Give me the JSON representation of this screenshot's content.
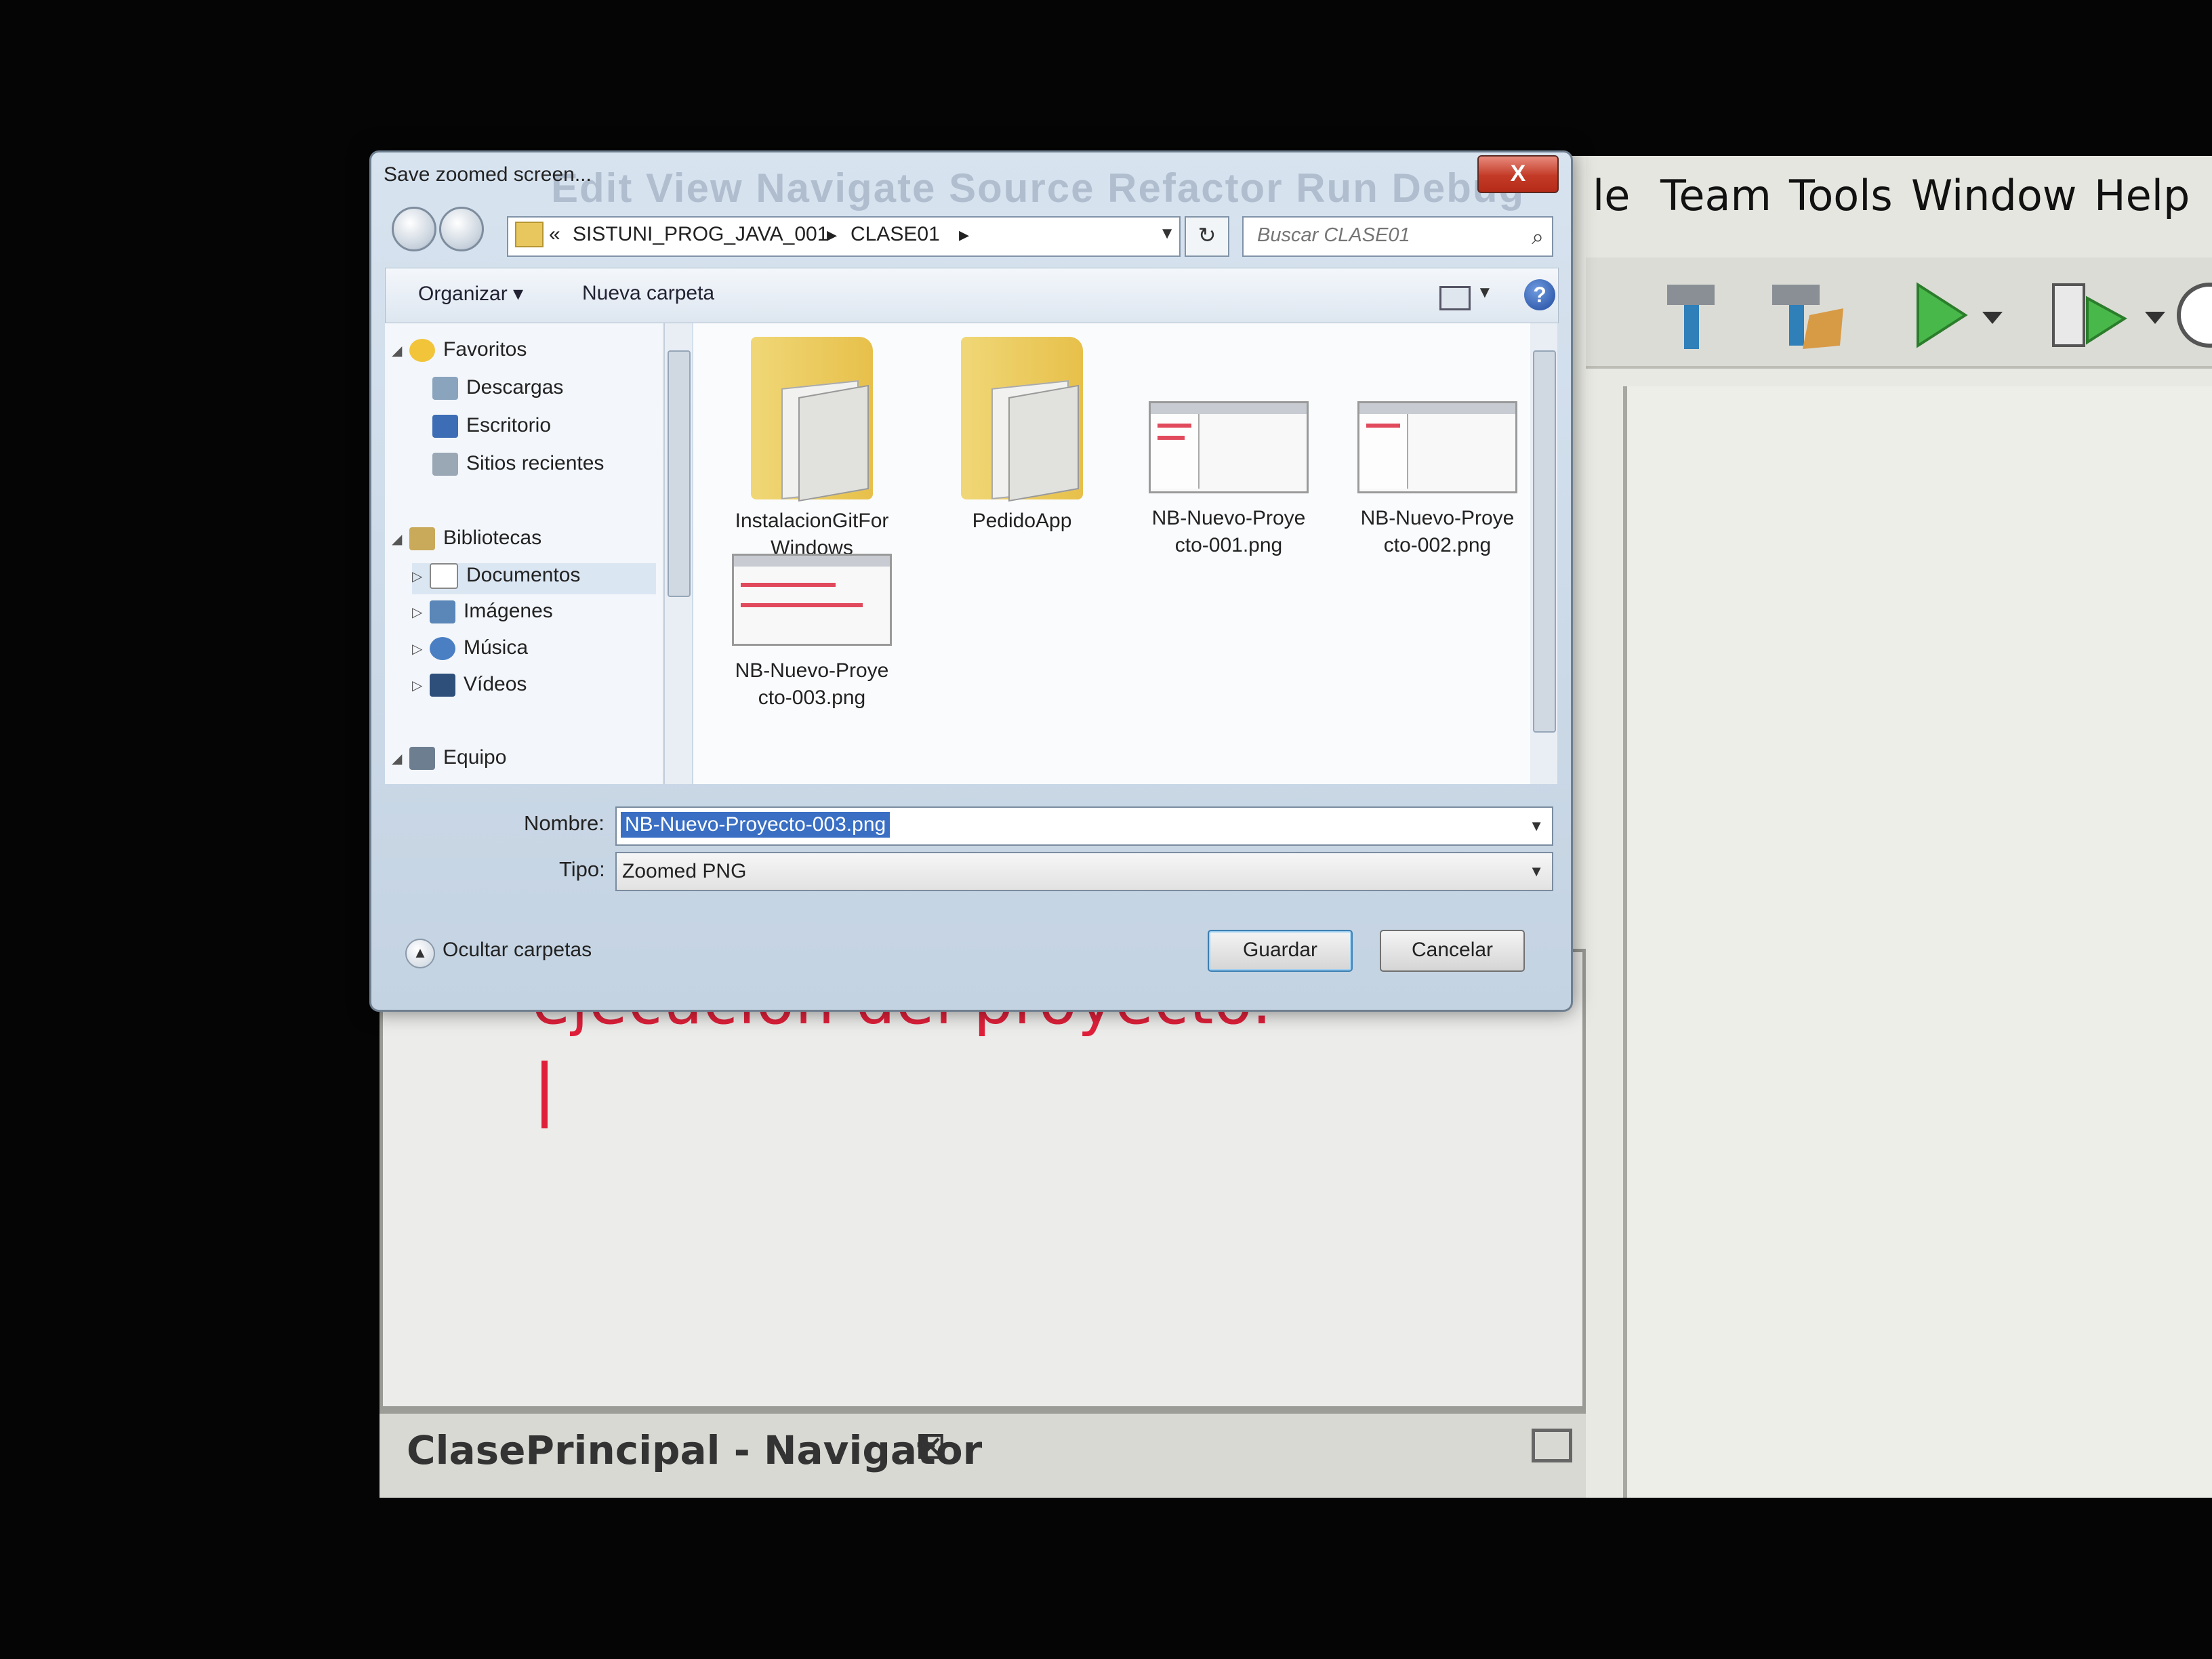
{
  "ide": {
    "menu": [
      "le",
      "Team",
      "Tools",
      "Window",
      "Help"
    ],
    "editor_text": "ejecucion del proyecto.",
    "bottom_tab_label": "ClasePrincipal - Navigator",
    "bottom_tab_close": "⊠"
  },
  "dialog": {
    "title": "Save zoomed screen...",
    "title_ghost": "Edit  View  Navigate  Source  Refactor  Run  Debug",
    "close_label": "X",
    "address": {
      "prefix": "«",
      "crumbs": [
        "SISTUNI_PROG_JAVA_001",
        "CLASE01"
      ],
      "separator": "▸"
    },
    "search": {
      "placeholder": "Buscar CLASE01"
    },
    "commands": {
      "organize": "Organizar ▾",
      "new_folder": "Nueva carpeta"
    },
    "nav": {
      "favorites": "Favoritos",
      "downloads": "Descargas",
      "desktop": "Escritorio",
      "recent": "Sitios recientes",
      "libraries": "Bibliotecas",
      "documents": "Documentos",
      "images": "Imágenes",
      "music": "Música",
      "videos": "Vídeos",
      "computer": "Equipo"
    },
    "files": [
      {
        "line1": "InstalacionGitFor",
        "line2": "Windows"
      },
      {
        "line1": "PedidoApp",
        "line2": ""
      },
      {
        "line1": "NB-Nuevo-Proye",
        "line2": "cto-001.png"
      },
      {
        "line1": "NB-Nuevo-Proye",
        "line2": "cto-002.png"
      },
      {
        "line1": "NB-Nuevo-Proye",
        "line2": "cto-003.png"
      }
    ],
    "form": {
      "name_label": "Nombre:",
      "name_value": "NB-Nuevo-Proyecto-003.png",
      "type_label": "Tipo:",
      "type_value": "Zoomed PNG"
    },
    "footer": {
      "hide_folders": "Ocultar carpetas",
      "save": "Guardar",
      "cancel": "Cancelar"
    }
  },
  "colors": {
    "editor_text": "#e0203a",
    "selection": "#3a6fc4",
    "close_button": "#c33a26"
  }
}
